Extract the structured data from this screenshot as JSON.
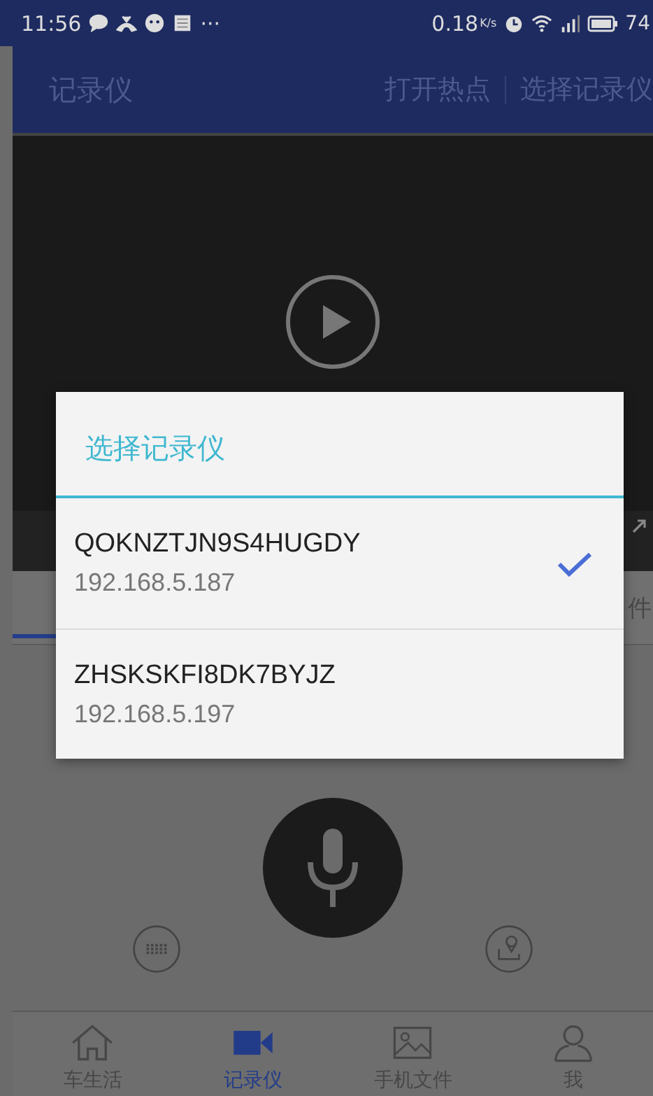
{
  "status_bar": {
    "time": "11:56",
    "more": "···",
    "speed": "0.18",
    "speed_unit": "K/s",
    "battery": "74"
  },
  "app_bar": {
    "title": "记录仪",
    "actions": [
      "打开热点",
      "选择记录仪"
    ]
  },
  "tabs": [
    {
      "selected": true
    },
    {
      "label": "件",
      "selected": false
    }
  ],
  "bottom_nav": [
    {
      "label": "车生活",
      "kind": "home",
      "selected": false
    },
    {
      "label": "记录仪",
      "kind": "camera",
      "selected": true
    },
    {
      "label": "手机文件",
      "kind": "image",
      "selected": false
    },
    {
      "label": "我",
      "kind": "person",
      "selected": false
    }
  ],
  "dialog": {
    "title": "选择记录仪",
    "items": [
      {
        "name": "QOKNZTJN9S4HUGDY",
        "address": "192.168.5.187",
        "selected": true
      },
      {
        "name": "ZHSKSKFI8DK7BYJZ",
        "address": "192.168.5.197",
        "selected": false
      }
    ]
  }
}
